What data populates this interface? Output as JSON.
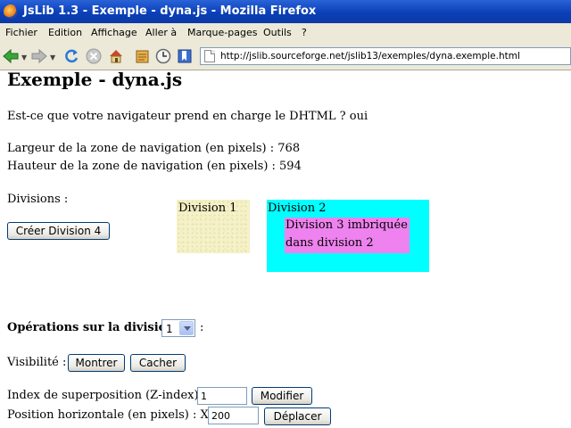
{
  "window": {
    "title": "JsLib 1.3 - Exemple - dyna.js - Mozilla Firefox",
    "menu": [
      "Fichier",
      "Edition",
      "Affichage",
      "Aller à",
      "Marque-pages",
      "Outils",
      "?"
    ]
  },
  "toolbar": {
    "icons": [
      "back-icon",
      "forward-icon",
      "reload-icon",
      "stop-icon",
      "home-icon",
      "history-icon",
      "bookmarks-icon"
    ],
    "url": "http://jslib.sourceforge.net/jslib13/exemples/dyna.exemple.html"
  },
  "page": {
    "heading": "Exemple - dyna.js",
    "dhtml_question": "Est-ce que votre navigateur prend en charge le DHTML ? oui",
    "width_line": "Largeur de la zone de navigation (en pixels) : 768",
    "height_line": "Hauteur de la zone de navigation (en pixels) : 594",
    "divisions_label": "Divisions :",
    "create_button": "Créer Division 4",
    "division1": "Division 1",
    "division2": "Division 2",
    "division3_line1": "Division 3 imbriquée",
    "division3_line2": "dans division 2",
    "ops_label": "Opérations sur la division",
    "ops_colon": ":",
    "ops_select_value": "1",
    "visibility_label": "Visibilité :",
    "show_button": "Montrer",
    "hide_button": "Cacher",
    "zindex_label": "Index de superposition (Z-index) :",
    "zindex_value": "1",
    "modify_button": "Modifier",
    "hpos_label": "Position horizontale (en pixels) :  X =",
    "hpos_value": "200",
    "move_button": "Déplacer"
  },
  "colors": {
    "titlebar": "#0a3fb8",
    "chrome": "#ece9d8",
    "division2_bg": "#00ffff",
    "division3_bg": "#ee82ee",
    "division1_bg": "#f5f1c8"
  }
}
